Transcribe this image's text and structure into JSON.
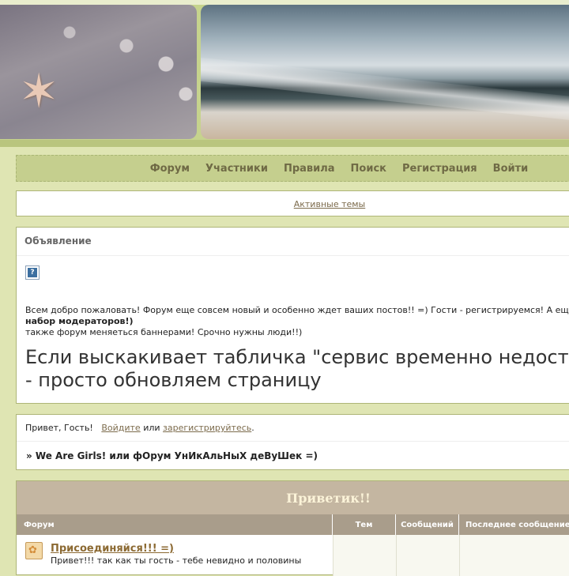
{
  "nav": {
    "items": [
      "Форум",
      "Участники",
      "Правила",
      "Поиск",
      "Регистрация",
      "Войти"
    ]
  },
  "active_topics": "Активные темы",
  "announcement": {
    "header": "Объявление",
    "line1": "Всем добро пожаловать! Форум еще совсем новый и особенно ждет ваших постов!! =) Гости - регистрируемся! А еще",
    "line2_bold": "набор модераторов!)",
    "line3": "также форум меняеться баннерами! Срочно нужны люди!!)",
    "big_line1": "Если выскакивает табличка \"сервис временно недост",
    "big_line2": "- просто обновляем страницу"
  },
  "guest": {
    "greeting": "Привет, Гость!",
    "login": "Войдите",
    "or": "или",
    "register": "зарегистрируйтесь",
    "period": ".",
    "breadcrumb": "» We Are Girls! или фОрум УнИкАльНыХ деВуШек =)"
  },
  "forum": {
    "category_title": "Приветик!!",
    "columns": [
      "Форум",
      "Тем",
      "Сообщений",
      "Последнее сообщение"
    ],
    "row": {
      "title": "Присоединяйся!!! =)",
      "desc": "Привет!!! так как ты гость - тебе невидно и половины"
    }
  },
  "colors": {
    "page_bg": "#dfe5b3",
    "nav_bg": "#c5cf8e",
    "category_bg": "#c4b6a1",
    "column_header_bg": "#a99d8b",
    "link": "#7c6b4c"
  }
}
